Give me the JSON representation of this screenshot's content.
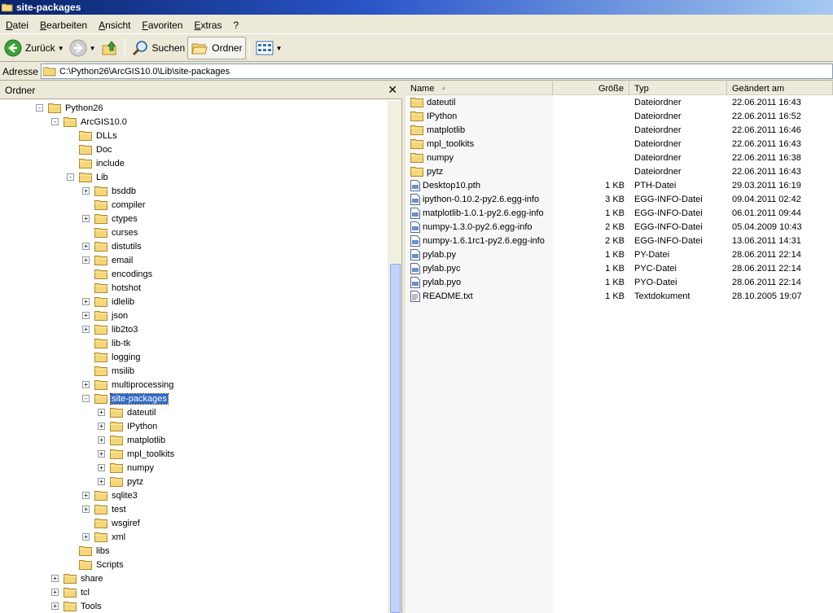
{
  "window": {
    "title": "site-packages"
  },
  "menu": [
    "Datei",
    "Bearbeiten",
    "Ansicht",
    "Favoriten",
    "Extras",
    "?"
  ],
  "toolbar": {
    "back": "Zurück",
    "search": "Suchen",
    "folders": "Ordner"
  },
  "address": {
    "label": "Adresse",
    "path": "C:\\Python26\\ArcGIS10.0\\Lib\\site-packages"
  },
  "left_pane": {
    "title": "Ordner",
    "close": "✕",
    "tree": [
      {
        "label": "Python26",
        "level": 0,
        "exp": "-"
      },
      {
        "label": "ArcGIS10.0",
        "level": 1,
        "exp": "-"
      },
      {
        "label": "DLLs",
        "level": 2,
        "exp": ""
      },
      {
        "label": "Doc",
        "level": 2,
        "exp": ""
      },
      {
        "label": "include",
        "level": 2,
        "exp": ""
      },
      {
        "label": "Lib",
        "level": 2,
        "exp": "-"
      },
      {
        "label": "bsddb",
        "level": 3,
        "exp": "+"
      },
      {
        "label": "compiler",
        "level": 3,
        "exp": ""
      },
      {
        "label": "ctypes",
        "level": 3,
        "exp": "+"
      },
      {
        "label": "curses",
        "level": 3,
        "exp": ""
      },
      {
        "label": "distutils",
        "level": 3,
        "exp": "+"
      },
      {
        "label": "email",
        "level": 3,
        "exp": "+"
      },
      {
        "label": "encodings",
        "level": 3,
        "exp": ""
      },
      {
        "label": "hotshot",
        "level": 3,
        "exp": ""
      },
      {
        "label": "idlelib",
        "level": 3,
        "exp": "+"
      },
      {
        "label": "json",
        "level": 3,
        "exp": "+"
      },
      {
        "label": "lib2to3",
        "level": 3,
        "exp": "+"
      },
      {
        "label": "lib-tk",
        "level": 3,
        "exp": ""
      },
      {
        "label": "logging",
        "level": 3,
        "exp": ""
      },
      {
        "label": "msilib",
        "level": 3,
        "exp": ""
      },
      {
        "label": "multiprocessing",
        "level": 3,
        "exp": "+"
      },
      {
        "label": "site-packages",
        "level": 3,
        "exp": "-",
        "selected": true
      },
      {
        "label": "dateutil",
        "level": 4,
        "exp": "+"
      },
      {
        "label": "IPython",
        "level": 4,
        "exp": "+"
      },
      {
        "label": "matplotlib",
        "level": 4,
        "exp": "+"
      },
      {
        "label": "mpl_toolkits",
        "level": 4,
        "exp": "+"
      },
      {
        "label": "numpy",
        "level": 4,
        "exp": "+"
      },
      {
        "label": "pytz",
        "level": 4,
        "exp": "+"
      },
      {
        "label": "sqlite3",
        "level": 3,
        "exp": "+"
      },
      {
        "label": "test",
        "level": 3,
        "exp": "+"
      },
      {
        "label": "wsgiref",
        "level": 3,
        "exp": ""
      },
      {
        "label": "xml",
        "level": 3,
        "exp": "+"
      },
      {
        "label": "libs",
        "level": 2,
        "exp": ""
      },
      {
        "label": "Scripts",
        "level": 2,
        "exp": ""
      },
      {
        "label": "share",
        "level": 1,
        "exp": "+"
      },
      {
        "label": "tcl",
        "level": 1,
        "exp": "+"
      },
      {
        "label": "Tools",
        "level": 1,
        "exp": "+"
      }
    ]
  },
  "columns": [
    "Name",
    "Größe",
    "Typ",
    "Geändert am"
  ],
  "files": [
    {
      "name": "dateutil",
      "size": "",
      "type": "Dateiordner",
      "date": "22.06.2011 16:43",
      "icon": "folder"
    },
    {
      "name": "IPython",
      "size": "",
      "type": "Dateiordner",
      "date": "22.06.2011 16:52",
      "icon": "folder"
    },
    {
      "name": "matplotlib",
      "size": "",
      "type": "Dateiordner",
      "date": "22.06.2011 16:46",
      "icon": "folder"
    },
    {
      "name": "mpl_toolkits",
      "size": "",
      "type": "Dateiordner",
      "date": "22.06.2011 16:43",
      "icon": "folder"
    },
    {
      "name": "numpy",
      "size": "",
      "type": "Dateiordner",
      "date": "22.06.2011 16:38",
      "icon": "folder"
    },
    {
      "name": "pytz",
      "size": "",
      "type": "Dateiordner",
      "date": "22.06.2011 16:43",
      "icon": "folder"
    },
    {
      "name": "Desktop10.pth",
      "size": "1 KB",
      "type": "PTH-Datei",
      "date": "29.03.2011 16:19",
      "icon": "file"
    },
    {
      "name": "ipython-0.10.2-py2.6.egg-info",
      "size": "3 KB",
      "type": "EGG-INFO-Datei",
      "date": "09.04.2011 02:42",
      "icon": "file"
    },
    {
      "name": "matplotlib-1.0.1-py2.6.egg-info",
      "size": "1 KB",
      "type": "EGG-INFO-Datei",
      "date": "06.01.2011 09:44",
      "icon": "file"
    },
    {
      "name": "numpy-1.3.0-py2.6.egg-info",
      "size": "2 KB",
      "type": "EGG-INFO-Datei",
      "date": "05.04.2009 10:43",
      "icon": "file"
    },
    {
      "name": "numpy-1.6.1rc1-py2.6.egg-info",
      "size": "2 KB",
      "type": "EGG-INFO-Datei",
      "date": "13.06.2011 14:31",
      "icon": "file"
    },
    {
      "name": "pylab.py",
      "size": "1 KB",
      "type": "PY-Datei",
      "date": "28.06.2011 22:14",
      "icon": "file"
    },
    {
      "name": "pylab.pyc",
      "size": "1 KB",
      "type": "PYC-Datei",
      "date": "28.06.2011 22:14",
      "icon": "file"
    },
    {
      "name": "pylab.pyo",
      "size": "1 KB",
      "type": "PYO-Datei",
      "date": "28.06.2011 22:14",
      "icon": "file"
    },
    {
      "name": "README.txt",
      "size": "1 KB",
      "type": "Textdokument",
      "date": "28.10.2005 19:07",
      "icon": "text"
    }
  ]
}
